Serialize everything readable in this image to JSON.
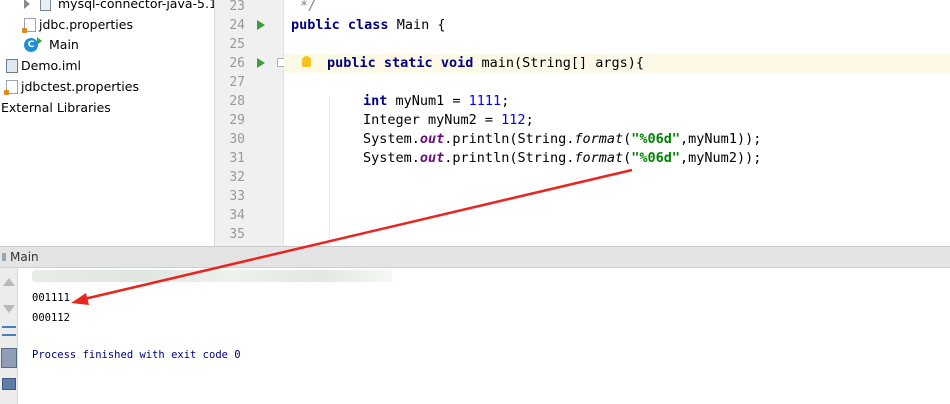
{
  "project_tree": {
    "items": [
      {
        "label": "mysql-connector-java-5.1.",
        "icon": "jar-icon"
      },
      {
        "label": "jdbc.properties",
        "icon": "properties-file-icon"
      },
      {
        "label": "Main",
        "icon": "java-class-icon"
      },
      {
        "label": "Demo.iml",
        "icon": "iml-file-icon"
      },
      {
        "label": "jdbctest.properties",
        "icon": "properties-file-icon"
      },
      {
        "label": "External Libraries",
        "icon": ""
      }
    ]
  },
  "editor": {
    "line_numbers": [
      "23",
      "24",
      "25",
      "26",
      "27",
      "28",
      "29",
      "30",
      "31",
      "32",
      "33",
      "34",
      "35"
    ],
    "comment_fragment": "*/",
    "class_decl": {
      "kw1": "public",
      "kw2": "class",
      "rest": " Main {"
    },
    "main_decl": {
      "kw1": "public",
      "kw2": "static",
      "kw3": "void",
      "rest": " main(String[] args){"
    },
    "line28": {
      "kw": "int",
      "mid": " myNum1 = ",
      "num": "1111",
      "end": ";"
    },
    "line29": {
      "pre": "Integer myNum2 = ",
      "num": "112",
      "end": ";"
    },
    "line30": {
      "a": "System.",
      "b": "out",
      "c": ".println(String.",
      "d": "format",
      "e": "(",
      "f": "\"%06d\"",
      "g": ",myNum1));"
    },
    "line31": {
      "a": "System.",
      "b": "out",
      "c": ".println(String.",
      "d": "format",
      "e": "(",
      "f": "\"%06d\"",
      "g": ",myNum2));"
    }
  },
  "run_panel": {
    "tab_label": "Main",
    "output": [
      "001111",
      "000112"
    ],
    "exit_message": "Process finished with exit code 0"
  },
  "colors": {
    "annotation_arrow": "#e8261f",
    "keyword": "#000080",
    "number": "#0000ff",
    "string": "#008000"
  }
}
